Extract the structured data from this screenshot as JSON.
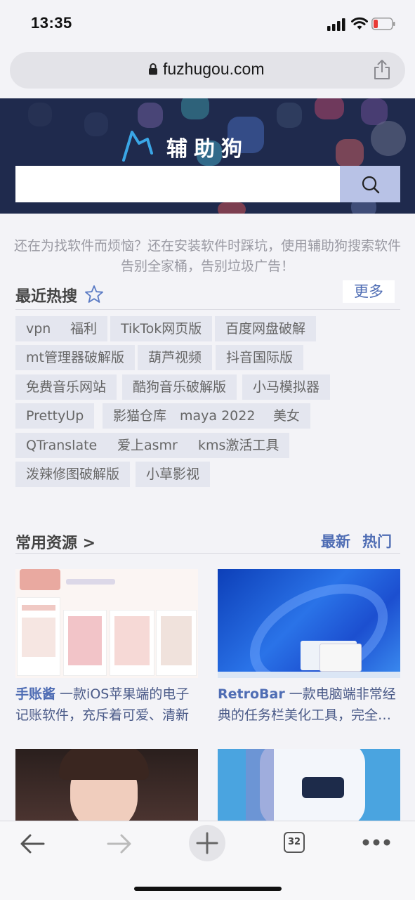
{
  "status": {
    "time": "13:35"
  },
  "browser": {
    "url": "fuzhugou.com",
    "tab_count": "32"
  },
  "site": {
    "title": "辅助狗",
    "search_placeholder": "",
    "intro": "还在为找软件而烦恼？还在安装软件时踩坑，使用辅助狗搜索软件告别全家桶，告别垃圾广告！"
  },
  "hot": {
    "title": "最近热搜",
    "more": "更多",
    "tags": [
      "vpn",
      "福利",
      "TikTok网页版",
      "百度网盘破解",
      "mt管理器破解版",
      "葫芦视频",
      "抖音国际版",
      "免费音乐网站",
      "酷狗音乐破解版",
      "小马模拟器",
      "PrettyUp",
      "影猫仓库",
      "maya 2022",
      "美女",
      "QTranslate",
      "爱上asmr",
      "kms激活工具",
      "泼辣修图破解版",
      "小草影视"
    ]
  },
  "resources": {
    "title": "常用资源 >",
    "tab_newest": "最新",
    "tab_hot": "热门",
    "cards": [
      {
        "name": "手账酱",
        "desc": " 一款iOS苹果端的电子记账软件，充斥着可爱、清新"
      },
      {
        "name": "RetroBar",
        "desc": " 一款电脑端非常经典的任务栏美化工具，完全…"
      },
      {
        "name": "",
        "desc": ""
      },
      {
        "name": "",
        "desc": ""
      }
    ]
  },
  "colors": {
    "accent": "#4f6db4",
    "banner": "#1f2a4d",
    "tag_bg": "#e4e6ef"
  }
}
